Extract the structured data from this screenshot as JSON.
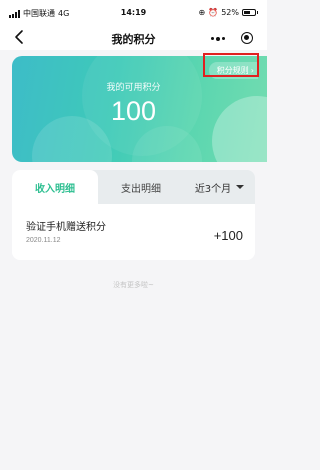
{
  "status_bar": {
    "carrier": "中国联通",
    "network": "4G",
    "time": "14:19",
    "battery": "52%"
  },
  "nav": {
    "title": "我的积分"
  },
  "points_card": {
    "label": "我的可用积分",
    "value": "100",
    "rules_link": "积分规则",
    "rules_chevron": "›",
    "gradient_colors": [
      "#3dbcc8",
      "#73dcb0"
    ]
  },
  "tabs": {
    "income": "收入明细",
    "expense": "支出明细",
    "range": "近3个月",
    "active_color": "#2ebf91"
  },
  "records": [
    {
      "title": "验证手机赠送积分",
      "date": "2020.11.12",
      "amount": "+100"
    }
  ],
  "footer": {
    "no_more": "没有更多啦~"
  },
  "highlight_color": "#e02020"
}
